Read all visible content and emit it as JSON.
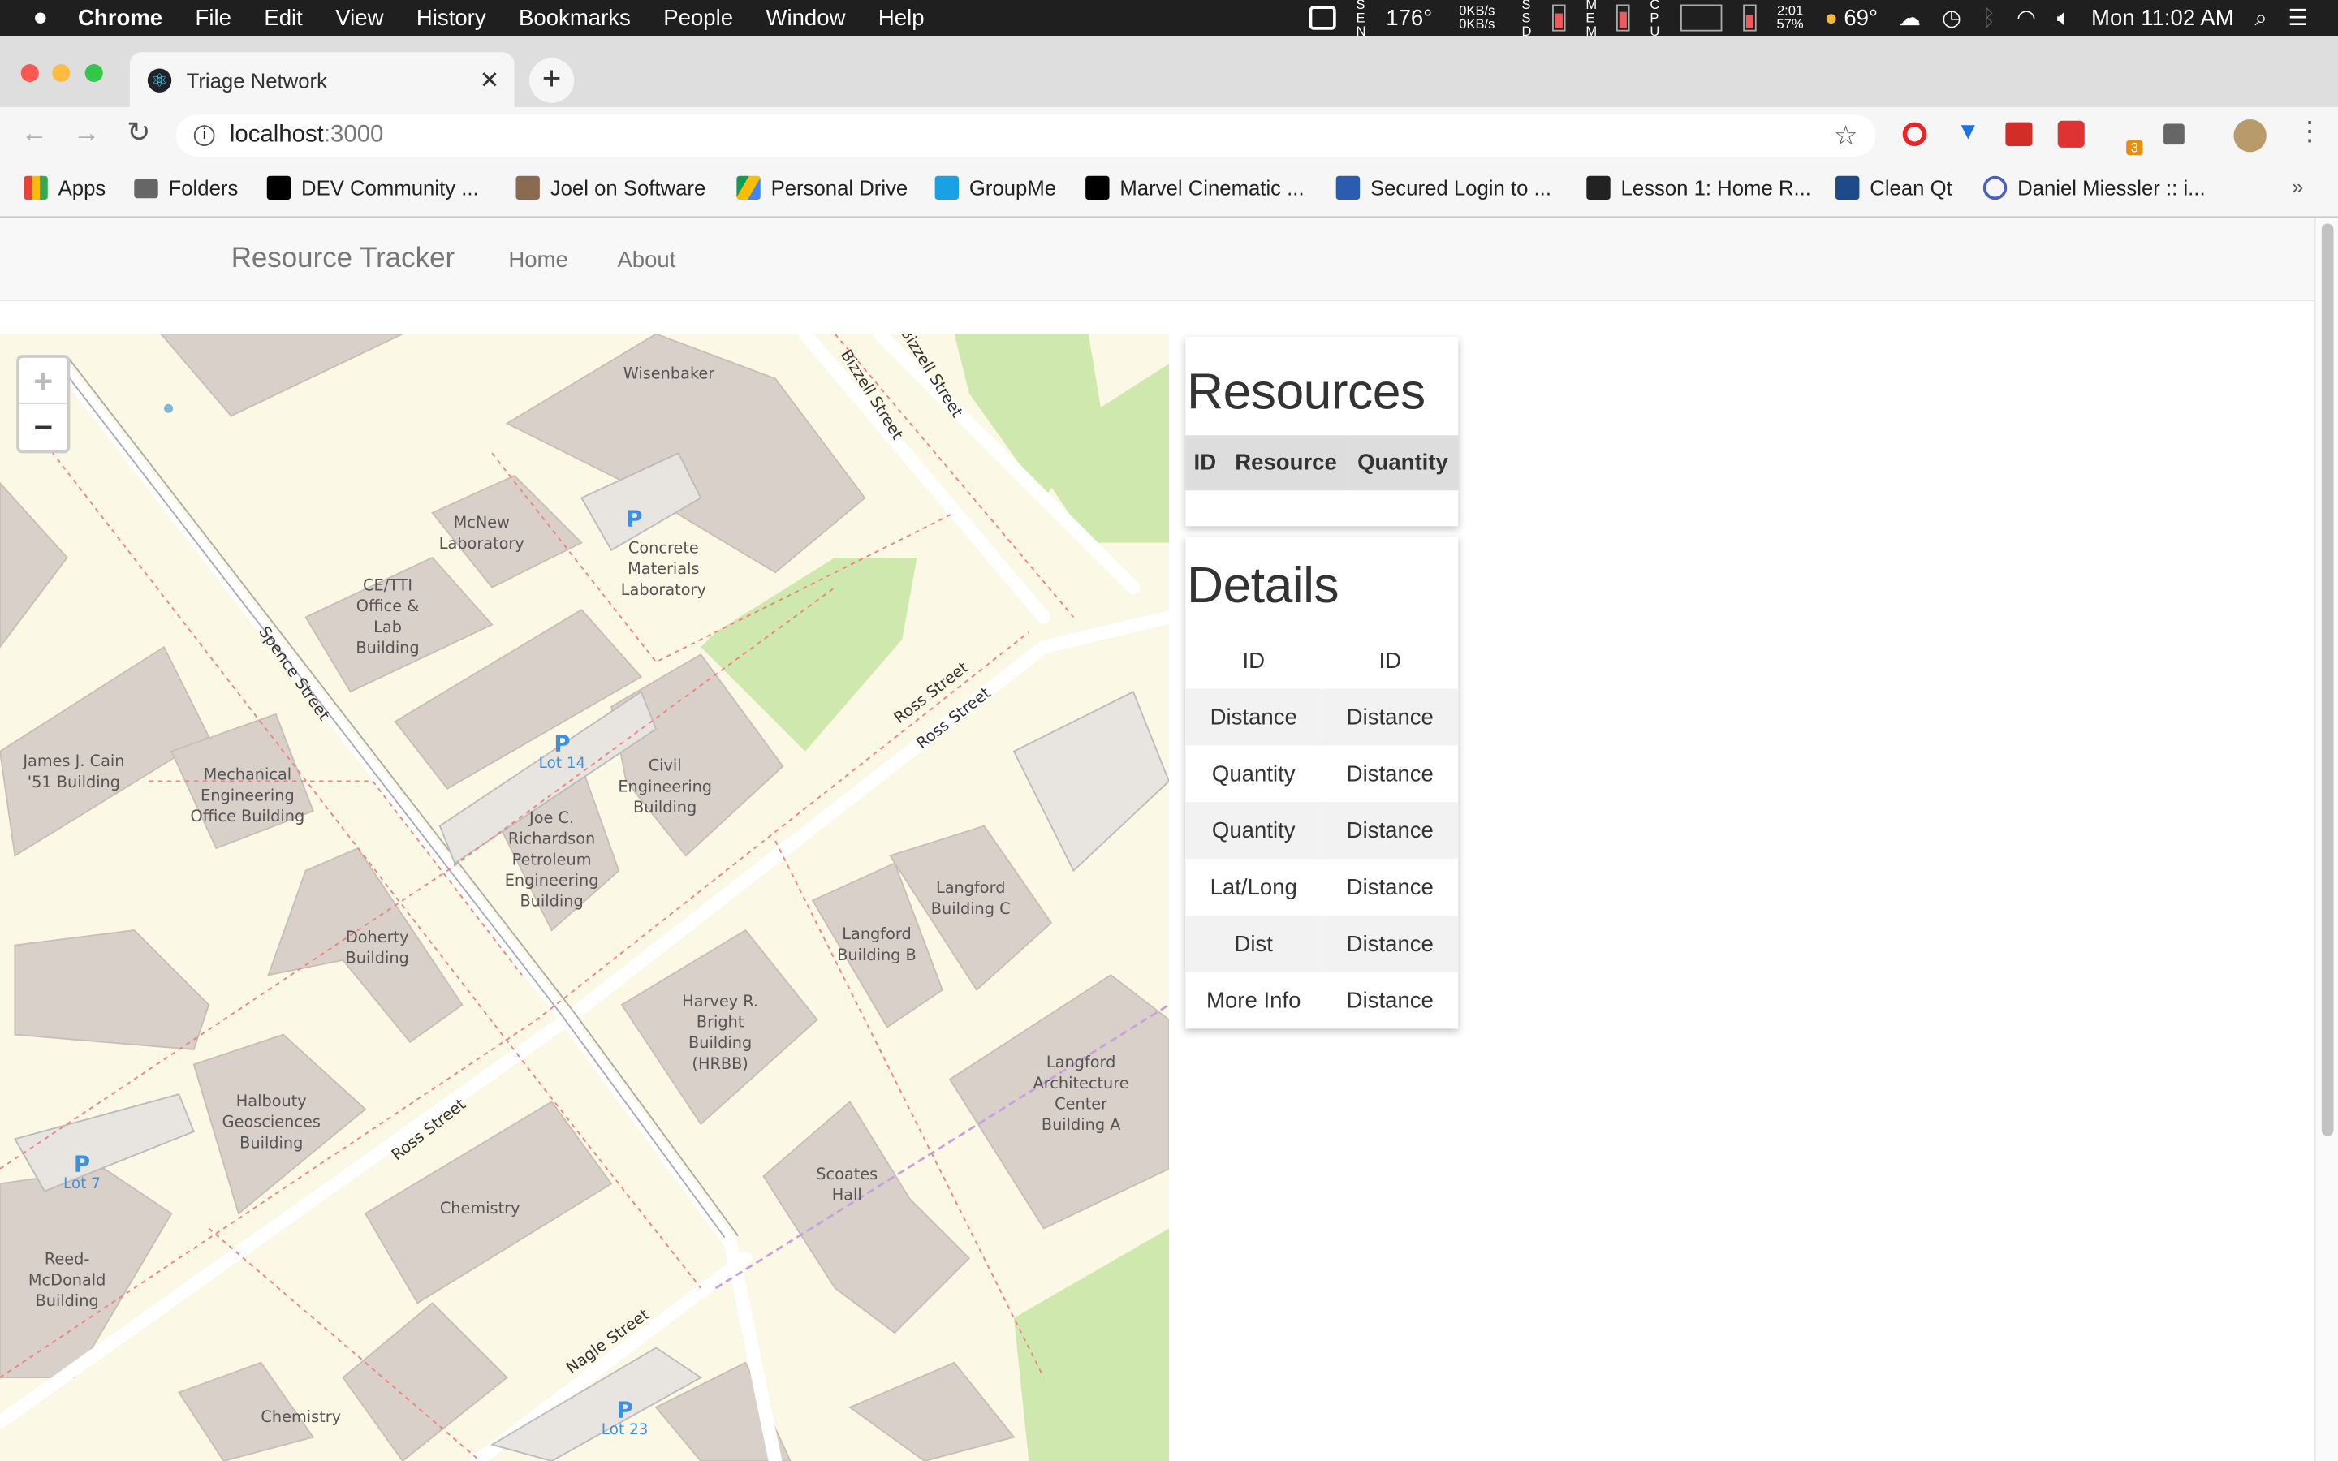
{
  "menubar": {
    "app": "Chrome",
    "items": [
      "File",
      "Edit",
      "View",
      "History",
      "Bookmarks",
      "People",
      "Window",
      "Help"
    ],
    "temp": "176°",
    "sen": "SEN",
    "net_up": "0KB/s",
    "net_down": "0KB/s",
    "ssd": "SSD",
    "mem": "MEM",
    "cpu": "CPU",
    "battery_time": "2:01",
    "battery_pct": "57%",
    "weather": "69°",
    "clock": "Mon 11:02 AM"
  },
  "browser": {
    "tab_title": "Triage Network",
    "url_host": "localhost",
    "url_port": ":3000",
    "extension_badge": "3"
  },
  "bookmarks": [
    "Apps",
    "Folders",
    "DEV Community ...",
    "Joel on Software",
    "Personal Drive",
    "GroupMe",
    "Marvel Cinematic ...",
    "Secured Login to ...",
    "Lesson 1: Home R...",
    "Clean Qt",
    "Daniel Miessler :: i..."
  ],
  "navbar": {
    "brand": "Resource Tracker",
    "links": [
      "Home",
      "About"
    ]
  },
  "map": {
    "zoom_in": "+",
    "zoom_out": "−",
    "buildings": [
      "Wisenbaker",
      "McNew Laboratory",
      "Concrete Materials Laboratory",
      "CE/TTI Office & Lab Building",
      "James J. Cain '51 Building",
      "Mechanical Engineering Office Building",
      "Civil Engineering Building",
      "Joe C. Richardson Petroleum Engineering Building",
      "Doherty Building",
      "Langford Building C",
      "Langford Building B",
      "Harvey R. Bright Building (HRBB)",
      "Halbouty Geosciences Building",
      "Langford Architecture Center Building A",
      "Reed-McDonald Building",
      "Chemistry",
      "Scoates Hall",
      "Chemistry"
    ],
    "streets": [
      "Bizzell Street",
      "Bizzell Street",
      "Spence Street",
      "Ross Street",
      "Ross Street",
      "Ross Street",
      "Nagle Street"
    ],
    "parking": [
      {
        "symbol": "P",
        "label": ""
      },
      {
        "symbol": "P",
        "label": "Lot 14"
      },
      {
        "symbol": "P",
        "label": "Lot 7"
      },
      {
        "symbol": "P",
        "label": "Lot 23"
      }
    ]
  },
  "resources": {
    "title": "Resources",
    "columns": [
      "ID",
      "Resource",
      "Quantity"
    ],
    "rows": []
  },
  "details": {
    "title": "Details",
    "rows": [
      [
        "ID",
        "ID"
      ],
      [
        "Distance",
        "Distance"
      ],
      [
        "Quantity",
        "Distance"
      ],
      [
        "Quantity",
        "Distance"
      ],
      [
        "Lat/Long",
        "Distance"
      ],
      [
        "Dist",
        "Distance"
      ],
      [
        "More Info",
        "Distance"
      ]
    ]
  }
}
